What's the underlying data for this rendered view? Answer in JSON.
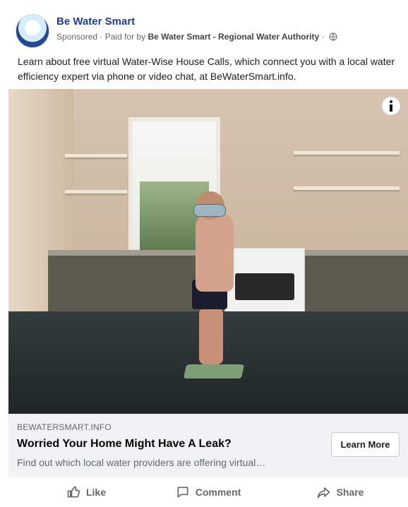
{
  "post": {
    "page_name": "Be Water Smart",
    "sponsored": "Sponsored",
    "paid_for_prefix": "Paid for by",
    "paid_for": "Be Water Smart - Regional Water Authority",
    "body": "Learn about free virtual Water-Wise House Calls, which connect you with a local water efficiency expert via phone or video chat, at BeWaterSmart.info."
  },
  "link": {
    "domain": "BEWATERSMART.INFO",
    "headline": "Worried Your Home Might Have A Leak?",
    "description": "Find out which local water providers are offering virtual…",
    "cta": "Learn More"
  },
  "actions": {
    "like": "Like",
    "comment": "Comment",
    "share": "Share"
  },
  "icons": {
    "info": "info-icon",
    "globe": "globe-icon",
    "like": "thumbs-up-icon",
    "comment": "comment-icon",
    "share": "share-icon"
  },
  "colors": {
    "page_name": "#223e84",
    "muted": "#65676b",
    "link_area": "#f0f2f5"
  }
}
